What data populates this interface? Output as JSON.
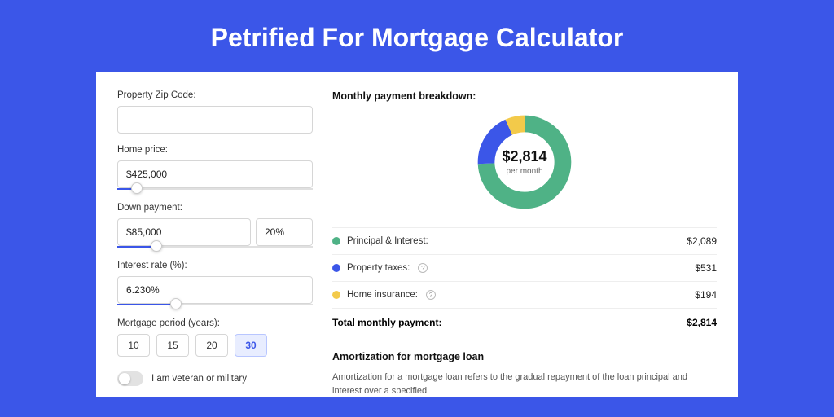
{
  "title": "Petrified For Mortgage Calculator",
  "form": {
    "zip_label": "Property Zip Code:",
    "zip_value": "",
    "home_price_label": "Home price:",
    "home_price_value": "$425,000",
    "home_price_slider_pct": 10,
    "down_payment_label": "Down payment:",
    "down_payment_value": "$85,000",
    "down_payment_pct": "20%",
    "down_payment_slider_pct": 20,
    "interest_label": "Interest rate (%):",
    "interest_value": "6.230%",
    "interest_slider_pct": 30,
    "period_label": "Mortgage period (years):",
    "periods": [
      "10",
      "15",
      "20",
      "30"
    ],
    "period_active": "30",
    "veteran_label": "I am veteran or military"
  },
  "breakdown": {
    "title": "Monthly payment breakdown:",
    "center_amount": "$2,814",
    "center_sub": "per month",
    "items": [
      {
        "label": "Principal & Interest:",
        "value": "$2,089",
        "color": "#4FB286",
        "info": false
      },
      {
        "label": "Property taxes:",
        "value": "$531",
        "color": "#3B56E8",
        "info": true
      },
      {
        "label": "Home insurance:",
        "value": "$194",
        "color": "#F3CA4A",
        "info": true
      }
    ],
    "total_label": "Total monthly payment:",
    "total_value": "$2,814"
  },
  "amort": {
    "title": "Amortization for mortgage loan",
    "text": "Amortization for a mortgage loan refers to the gradual repayment of the loan principal and interest over a specified"
  },
  "chart_data": {
    "type": "pie",
    "title": "Monthly payment breakdown",
    "series": [
      {
        "name": "Principal & Interest",
        "value": 2089,
        "color": "#4FB286"
      },
      {
        "name": "Property taxes",
        "value": 531,
        "color": "#3B56E8"
      },
      {
        "name": "Home insurance",
        "value": 194,
        "color": "#F3CA4A"
      }
    ],
    "total": 2814
  }
}
